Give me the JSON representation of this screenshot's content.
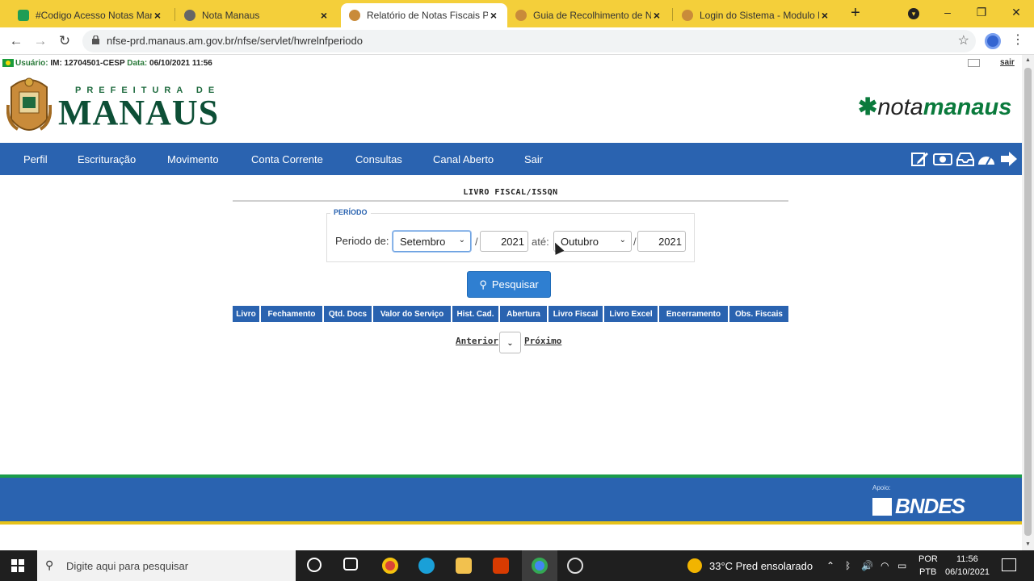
{
  "browser": {
    "tabs": [
      {
        "title": "#Codigo Acesso Notas Mana",
        "active": false
      },
      {
        "title": "Nota Manaus",
        "active": false
      },
      {
        "title": "Relatório de Notas Fiscais Por",
        "active": true
      },
      {
        "title": "Guia de Recolhimento de NF",
        "active": false
      },
      {
        "title": "Login do Sistema - Modulo N",
        "active": false
      }
    ],
    "url": "nfse-prd.manaus.am.gov.br/nfse/servlet/hwrelnfperiodo"
  },
  "topinfo": {
    "user_label": "Usuário:",
    "user_value": "IM: 12704501-CESP",
    "date_label": "Data:",
    "date_value": "06/10/2021 11:56",
    "logout": "sair"
  },
  "header": {
    "prefeitura_small": "PREFEITURA DE",
    "prefeitura_big": "MANAUS",
    "nota_light": "nota",
    "nota_bold": "manaus"
  },
  "nav": {
    "items": [
      "Perfil",
      "Escrituração",
      "Movimento",
      "Conta Corrente",
      "Consultas",
      "Canal Aberto",
      "Sair"
    ]
  },
  "main": {
    "title": "LIVRO FISCAL/ISSQN",
    "legend": "PERÍODO",
    "period_label": "Periodo de:",
    "from_month": "Setembro",
    "from_year": "2021",
    "until_label": "até:",
    "to_month": "Outubro",
    "to_year": "2021",
    "search_button": "Pesquisar",
    "columns": [
      "Livro",
      "Fechamento",
      "Qtd. Docs",
      "Valor do Serviço",
      "Hist. Cad.",
      "Abertura",
      "Livro Fiscal",
      "Livro Excel",
      "Encerramento",
      "Obs. Fiscais"
    ],
    "prev": "Anterior",
    "next": "Próximo"
  },
  "footer": {
    "apoio": "Apoio:",
    "sponsor": "BNDES"
  },
  "taskbar": {
    "search_placeholder": "Digite aqui para pesquisar",
    "weather": "33°C  Pred ensolarado",
    "lang_top": "POR",
    "lang_bottom": "PTB",
    "time": "11:56",
    "date": "06/10/2021"
  },
  "colors": {
    "tab_bar": "#f4cf3a",
    "nav_blue": "#2a63b0",
    "brand_green": "#0a7a3c"
  }
}
